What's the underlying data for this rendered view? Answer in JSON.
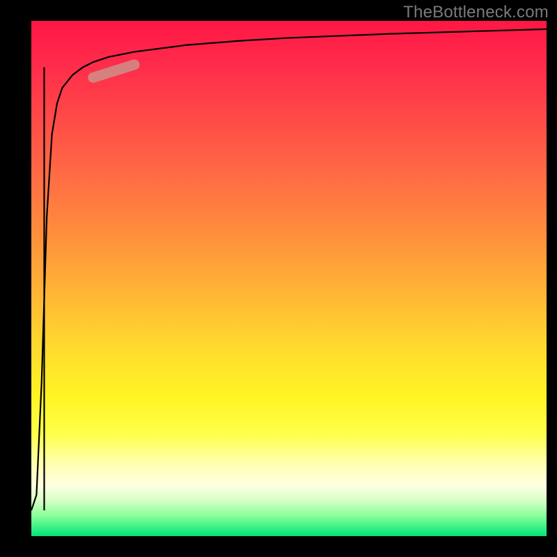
{
  "watermark": "TheBottleneck.com",
  "colors": {
    "gradient_top": "#ff1744",
    "gradient_mid": "#ffd92e",
    "gradient_bottom": "#00e676",
    "curve": "#000000",
    "marker": "#cf8c86",
    "background": "#000000",
    "watermark_text": "#7a7a7a"
  },
  "chart_data": {
    "type": "line",
    "title": "",
    "xlabel": "",
    "ylabel": "",
    "xlim": [
      0,
      100
    ],
    "ylim": [
      0,
      100
    ],
    "series": [
      {
        "name": "bottleneck-curve",
        "x": [
          0,
          1,
          2,
          3,
          4,
          5,
          6,
          8,
          10,
          12,
          15,
          20,
          30,
          40,
          50,
          60,
          70,
          80,
          90,
          100
        ],
        "y": [
          5,
          8,
          30,
          62,
          78,
          84,
          87,
          89.5,
          91,
          92,
          93,
          94,
          95.3,
          96.1,
          96.7,
          97.1,
          97.5,
          97.8,
          98.1,
          98.4
        ]
      }
    ],
    "spike": {
      "x": 2.5,
      "y_from": 5,
      "y_to": 91
    },
    "marker_segment": {
      "x_from": 12,
      "y_from": 89,
      "x_to": 20,
      "y_to": 91.5
    },
    "axes_visible": false,
    "grid": false,
    "legend": false,
    "background_gradient": "red→yellow→green (vertical)"
  }
}
